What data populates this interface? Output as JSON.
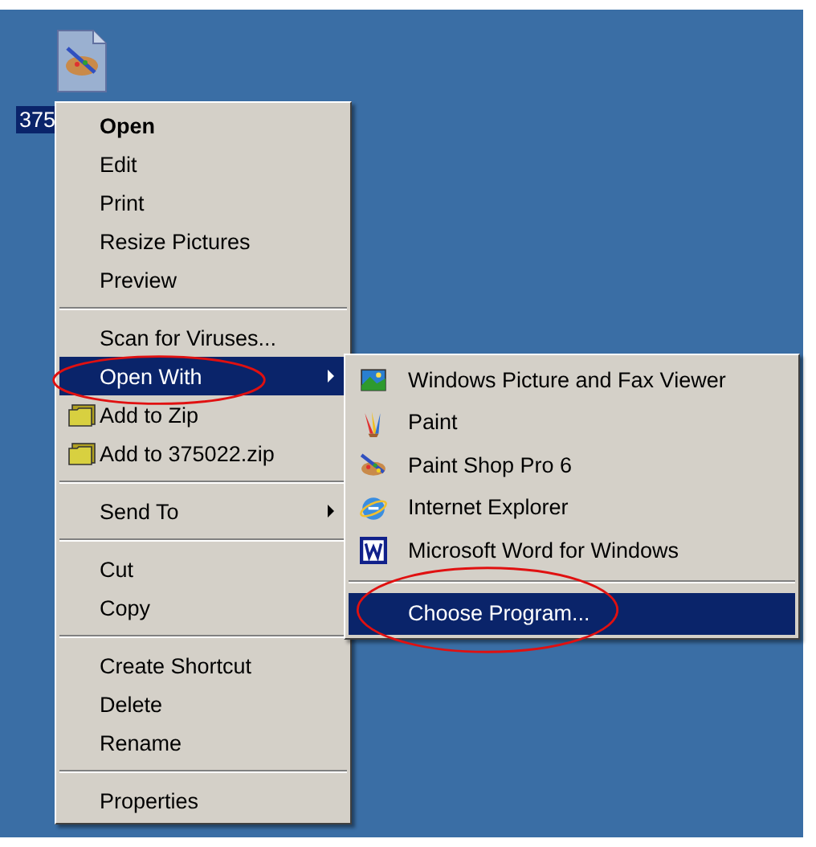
{
  "desktop_icon": {
    "label": "375",
    "selected": true
  },
  "context_menu": {
    "items": [
      {
        "kind": "item",
        "label": "Open",
        "bold": true,
        "selected": false
      },
      {
        "kind": "item",
        "label": "Edit",
        "selected": false
      },
      {
        "kind": "item",
        "label": "Print",
        "selected": false
      },
      {
        "kind": "item",
        "label": "Resize Pictures",
        "selected": false
      },
      {
        "kind": "item",
        "label": "Preview",
        "selected": false
      },
      {
        "kind": "separator"
      },
      {
        "kind": "item",
        "label": "Scan for Viruses...",
        "selected": false
      },
      {
        "kind": "item",
        "label": "Open With",
        "selected": true,
        "submenu": true,
        "circled": true
      },
      {
        "kind": "item",
        "label": "Add to Zip",
        "selected": false,
        "has_icon": true
      },
      {
        "kind": "item",
        "label": "Add to 375022.zip",
        "selected": false,
        "has_icon": true
      },
      {
        "kind": "separator"
      },
      {
        "kind": "item",
        "label": "Send To",
        "selected": false,
        "submenu": true
      },
      {
        "kind": "separator"
      },
      {
        "kind": "item",
        "label": "Cut",
        "selected": false
      },
      {
        "kind": "item",
        "label": "Copy",
        "selected": false
      },
      {
        "kind": "separator"
      },
      {
        "kind": "item",
        "label": "Create Shortcut",
        "selected": false
      },
      {
        "kind": "item",
        "label": "Delete",
        "selected": false
      },
      {
        "kind": "item",
        "label": "Rename",
        "selected": false
      },
      {
        "kind": "separator"
      },
      {
        "kind": "item",
        "label": "Properties",
        "selected": false
      }
    ]
  },
  "open_with_menu": {
    "items": [
      {
        "kind": "program",
        "label": "Windows Picture and Fax Viewer",
        "selected": false
      },
      {
        "kind": "program",
        "label": "Paint",
        "selected": false
      },
      {
        "kind": "program",
        "label": "Paint Shop Pro 6",
        "selected": false
      },
      {
        "kind": "program",
        "label": "Internet Explorer",
        "selected": false
      },
      {
        "kind": "program",
        "label": "Microsoft Word for Windows",
        "selected": false
      },
      {
        "kind": "separator"
      },
      {
        "kind": "item",
        "label": "Choose Program...",
        "selected": true,
        "circled": true
      }
    ]
  }
}
